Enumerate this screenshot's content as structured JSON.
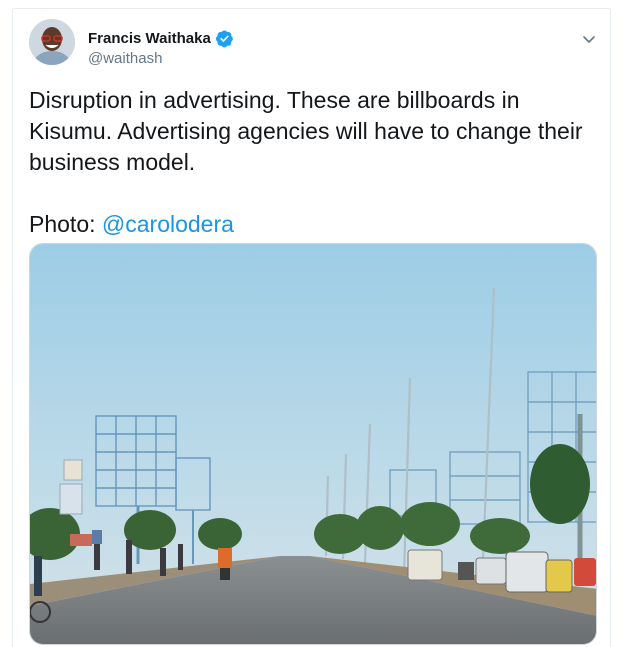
{
  "tweet": {
    "author": {
      "display_name": "Francis Waithaka",
      "handle": "@waithash",
      "verified": true,
      "avatar_icon": "avatar-photo"
    },
    "text_main": "Disruption in advertising. These are billboards in Kisumu. Advertising agencies will have to change their business model.",
    "photo_prefix": "Photo: ",
    "photo_mention": "@carolodera",
    "menu_icon": "chevron-down-icon"
  },
  "colors": {
    "accent": "#1b95e0",
    "verified": "#1da1f2",
    "secondary_text": "#657786",
    "border": "#e6ecf0"
  }
}
